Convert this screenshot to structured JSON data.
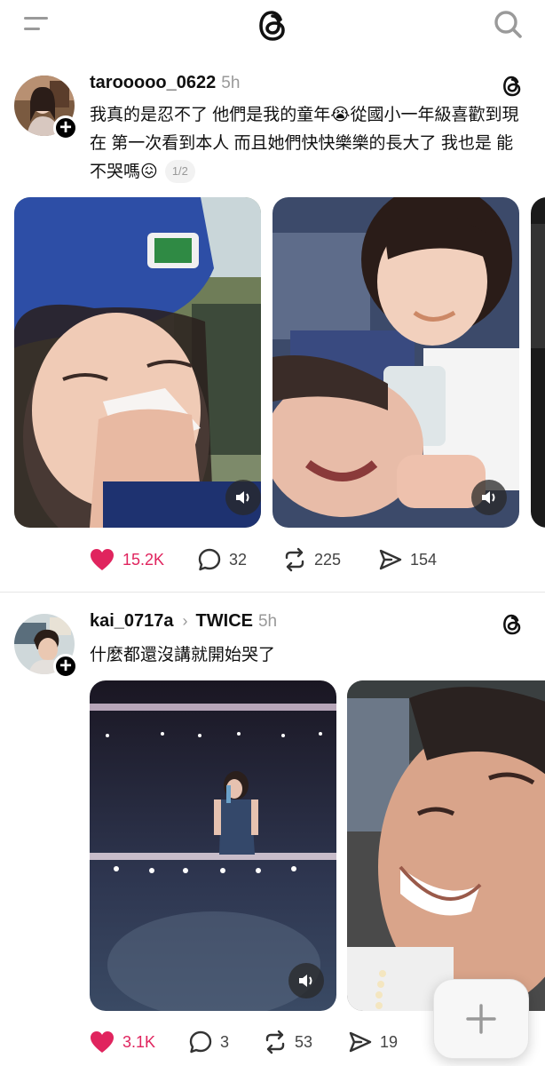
{
  "colors": {
    "like_red": "#e0245e",
    "text": "#101010",
    "muted": "#999999"
  },
  "icons": {
    "menu": "menu-icon",
    "logo": "threads-logo-icon",
    "search": "search-icon",
    "heart": "heart-icon",
    "comment": "comment-icon",
    "repost": "repost-icon",
    "share": "send-icon",
    "volume": "volume-icon",
    "compose": "plus-icon"
  },
  "posts": [
    {
      "username": "tarooooo_0622",
      "time": "5h",
      "text": "我真的是忍不了 他們是我的童年😭從國小一年級喜歡到現在 第一次看到本人 而且她們快快樂樂的長大了 我也是 能不哭嗎😖",
      "pager": "1/2",
      "likes": "15.2K",
      "liked": true,
      "comments": "32",
      "reposts": "225",
      "shares": "154"
    },
    {
      "username": "kai_0717a",
      "tag": "TWICE",
      "time": "5h",
      "text": "什麼都還沒講就開始哭了",
      "likes": "3.1K",
      "liked": true,
      "comments": "3",
      "reposts": "53",
      "shares": "19"
    }
  ],
  "fab": {
    "label": "+"
  }
}
